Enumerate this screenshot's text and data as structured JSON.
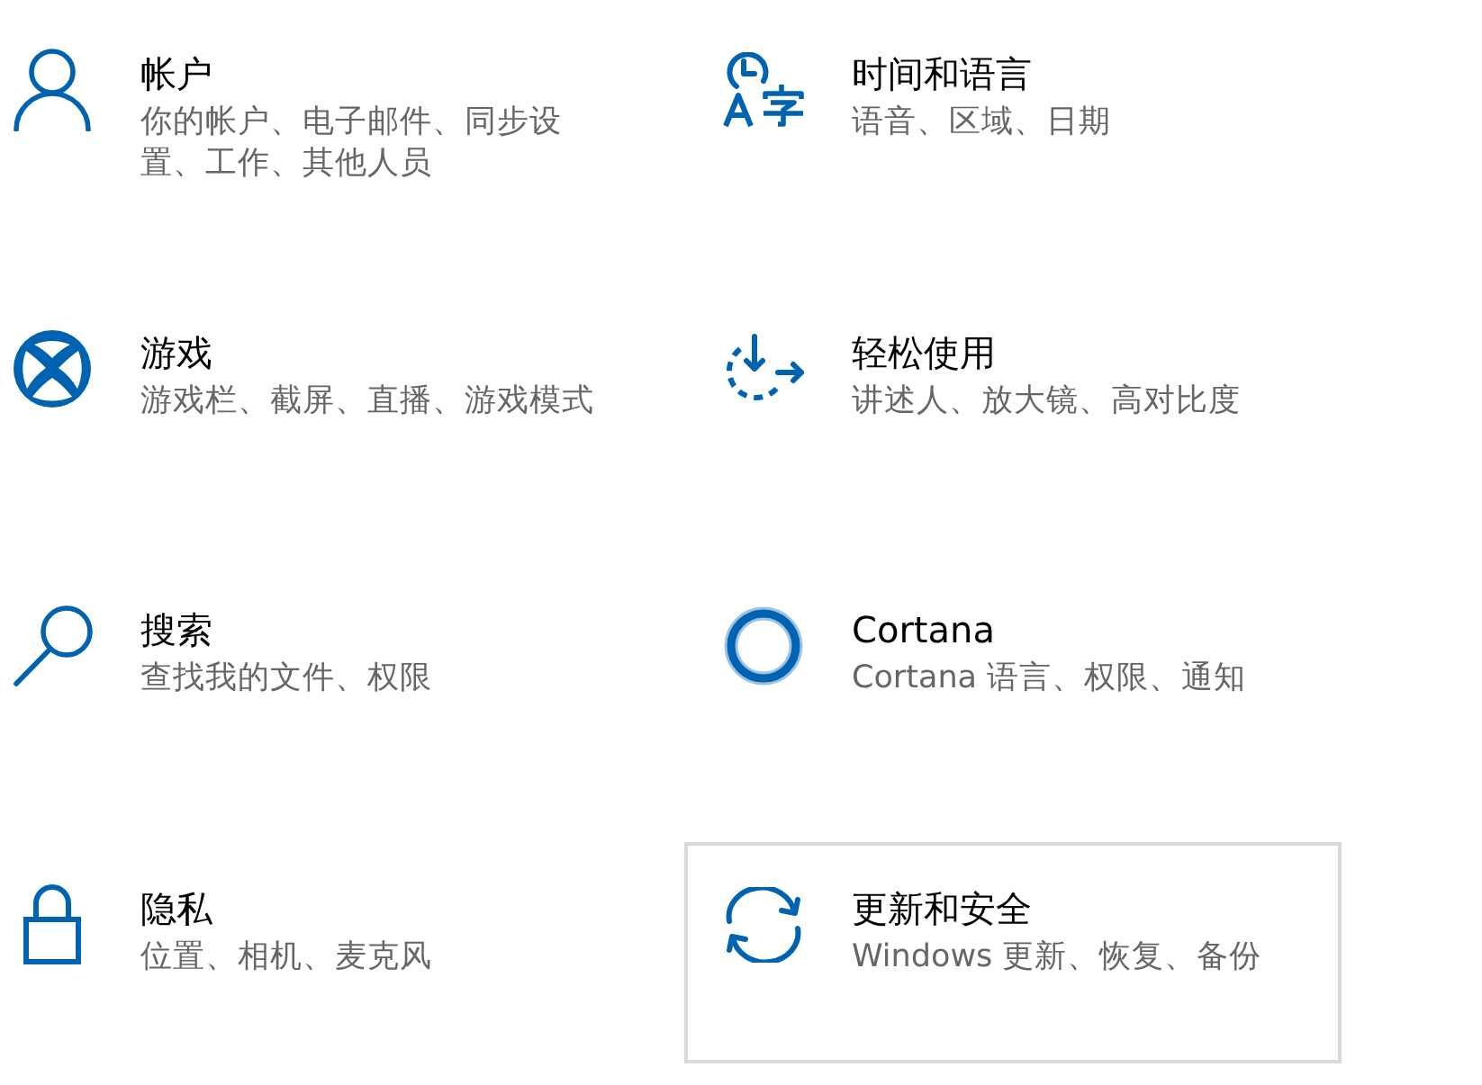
{
  "categories": [
    {
      "title": "帐户",
      "description": "你的帐户、电子邮件、同步设置、工作、其他人员",
      "highlighted": false
    },
    {
      "title": "时间和语言",
      "description": "语音、区域、日期",
      "highlighted": false
    },
    {
      "title": "游戏",
      "description": "游戏栏、截屏、直播、游戏模式",
      "highlighted": false
    },
    {
      "title": "轻松使用",
      "description": "讲述人、放大镜、高对比度",
      "highlighted": false
    },
    {
      "title": "搜索",
      "description": "查找我的文件、权限",
      "highlighted": false
    },
    {
      "title": "Cortana",
      "description": "Cortana 语言、权限、通知",
      "highlighted": false
    },
    {
      "title": "隐私",
      "description": "位置、相机、麦克风",
      "highlighted": false
    },
    {
      "title": "更新和安全",
      "description": "Windows 更新、恢复、备份",
      "highlighted": true
    }
  ]
}
